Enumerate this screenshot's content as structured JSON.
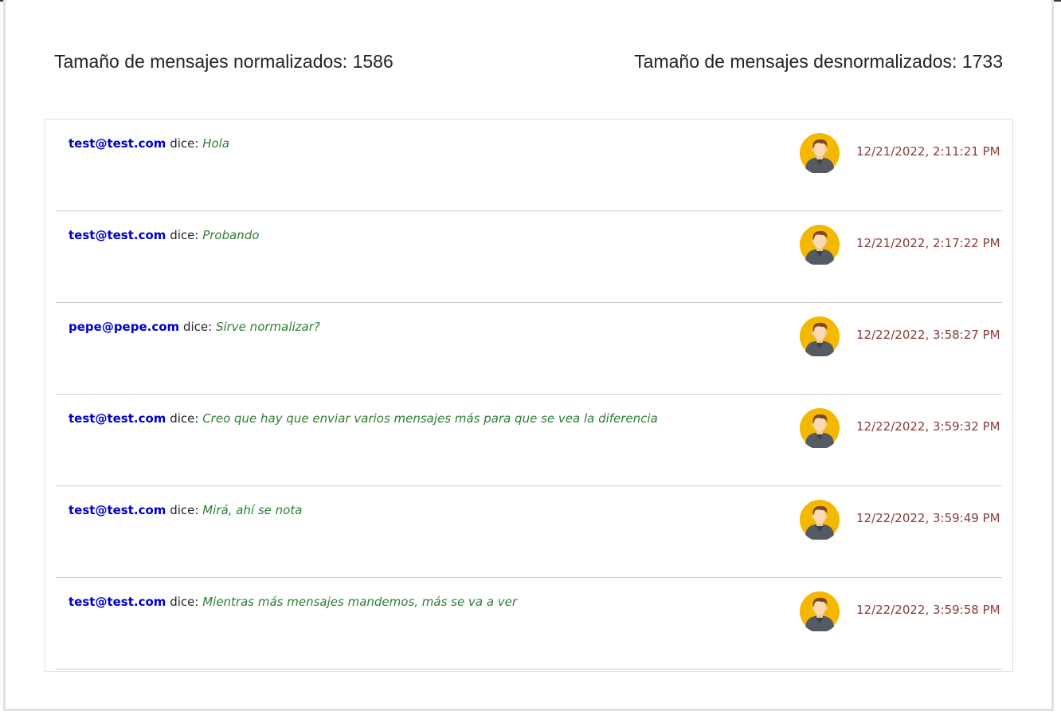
{
  "stats": {
    "normalized_label": "Tamaño de mensajes normalizados: 1586",
    "denormalized_label": "Tamaño de mensajes desnormalizados: 1733"
  },
  "messages": [
    {
      "author": "test@test.com",
      "says": "dice:",
      "text": "Hola",
      "date": "12/21/2022, 2:11:21 PM",
      "avatar_icon": "user-avatar-icon"
    },
    {
      "author": "test@test.com",
      "says": "dice:",
      "text": "Probando",
      "date": "12/21/2022, 2:17:22 PM",
      "avatar_icon": "user-avatar-icon"
    },
    {
      "author": "pepe@pepe.com",
      "says": "dice:",
      "text": "Sirve normalizar?",
      "date": "12/22/2022, 3:58:27 PM",
      "avatar_icon": "user-avatar-icon"
    },
    {
      "author": "test@test.com",
      "says": "dice:",
      "text": "Creo que hay que enviar varios mensajes más para que se vea la diferencia",
      "date": "12/22/2022, 3:59:32 PM",
      "avatar_icon": "user-avatar-icon"
    },
    {
      "author": "test@test.com",
      "says": "dice:",
      "text": "Mirá, ahí se nota",
      "date": "12/22/2022, 3:59:49 PM",
      "avatar_icon": "user-avatar-icon"
    },
    {
      "author": "test@test.com",
      "says": "dice:",
      "text": "Mientras más mensajes mandemos, más se va a ver",
      "date": "12/22/2022, 3:59:58 PM",
      "avatar_icon": "user-avatar-icon"
    }
  ],
  "colors": {
    "author": "#0000cc",
    "content": "#2e7d32",
    "date": "#8b3a3a",
    "avatar_bg": "#f5b800"
  }
}
